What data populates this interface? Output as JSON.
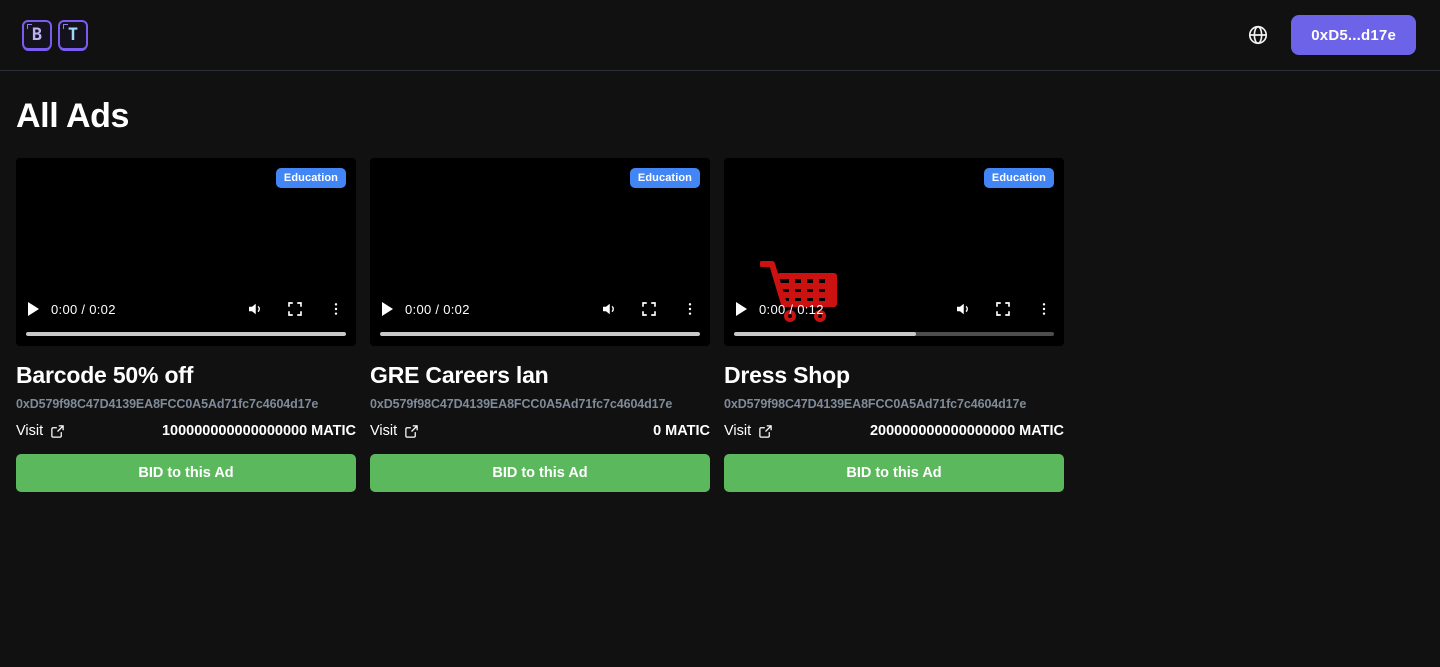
{
  "header": {
    "logo": {
      "tile1": "B",
      "tile2": "T"
    },
    "globe_icon": "globe-icon",
    "wallet_label": "0xD5...d17e",
    "wallet_color": "#6c63e8"
  },
  "page": {
    "title": "All Ads"
  },
  "cards": [
    {
      "badge": "Education",
      "badge_color": "#4286f5",
      "time": "0:00 / 0:02",
      "progress_percent": 100,
      "has_cart_art": false,
      "title": "Barcode 50% off",
      "address": "0xD579f98C47D4139EA8FCC0A5Ad71fc7c4604d17e",
      "visit_label": "Visit",
      "amount": "100000000000000000 MATIC",
      "bid_label": "BID to this Ad",
      "bid_color": "#5cb85c"
    },
    {
      "badge": "Education",
      "badge_color": "#4286f5",
      "time": "0:00 / 0:02",
      "progress_percent": 100,
      "has_cart_art": false,
      "title": "GRE Careers lan",
      "address": "0xD579f98C47D4139EA8FCC0A5Ad71fc7c4604d17e",
      "visit_label": "Visit",
      "amount": "0 MATIC",
      "bid_label": "BID to this Ad",
      "bid_color": "#5cb85c"
    },
    {
      "badge": "Education",
      "badge_color": "#4286f5",
      "time": "0:00 / 0:12",
      "progress_percent": 57,
      "has_cart_art": true,
      "cart_color": "#cc1111",
      "title": "Dress Shop",
      "address": "0xD579f98C47D4139EA8FCC0A5Ad71fc7c4604d17e",
      "visit_label": "Visit",
      "amount": "200000000000000000 MATIC",
      "bid_label": "BID to this Ad",
      "bid_color": "#5cb85c"
    }
  ]
}
